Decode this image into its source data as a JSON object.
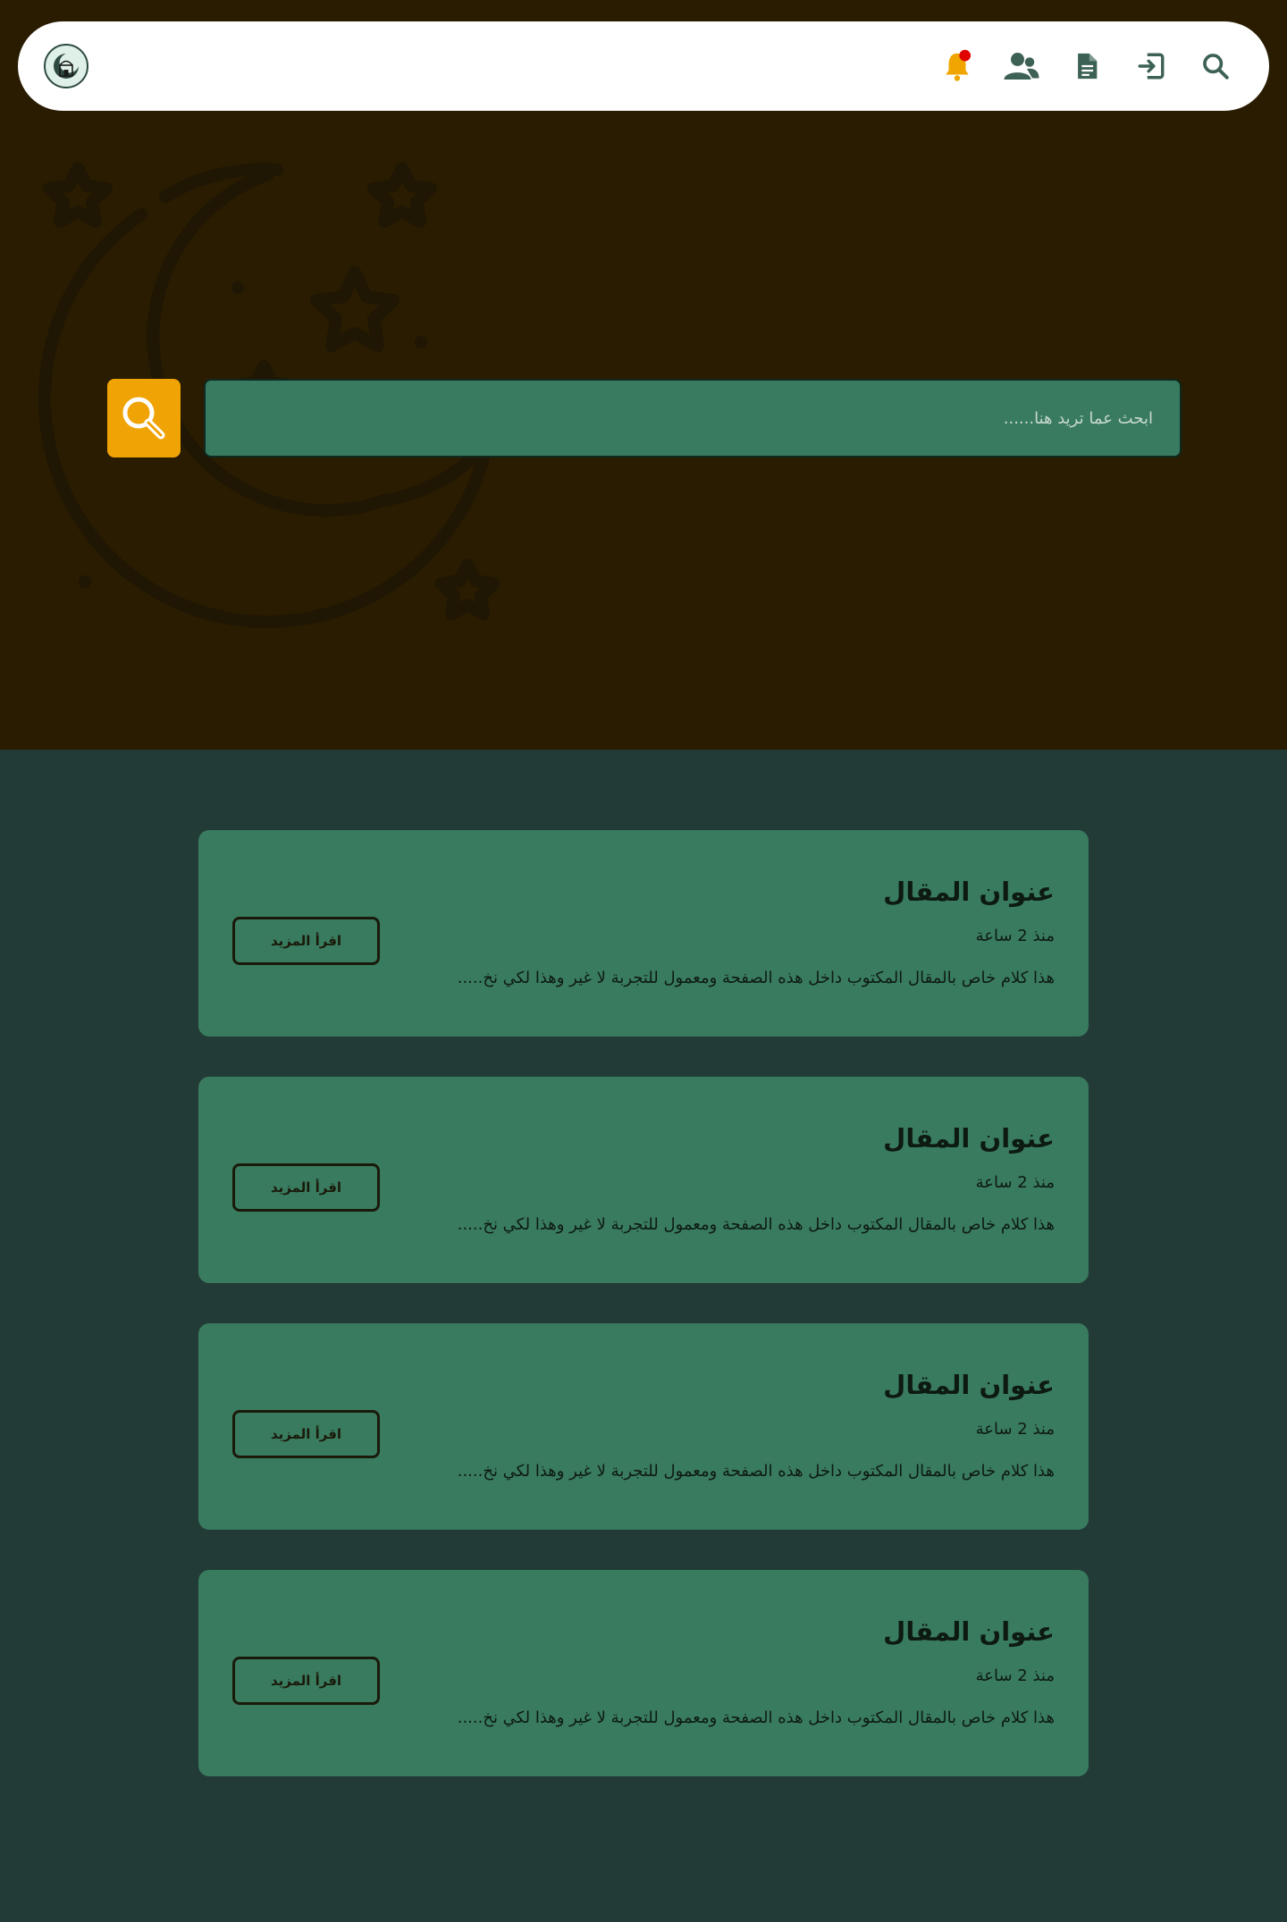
{
  "navbar": {
    "logo_icon": "mosque-logo-icon",
    "icons": [
      "search-icon",
      "login-icon",
      "document-icon",
      "users-icon",
      "bell-icon"
    ],
    "notification_dot_color": "#e00000",
    "bell_color": "#f0a500",
    "icon_color": "#3d6155"
  },
  "hero": {
    "background_color": "#291c01",
    "decoration_icon": "crescent-moon-stars-icon",
    "search": {
      "placeholder": "ابحث عما تريد هنا......",
      "button_icon": "magnifier-icon",
      "button_color": "#efa304"
    }
  },
  "articles": [
    {
      "title": "عنوان المقال",
      "time": "منذ 2 ساعة",
      "excerpt": "هذا كلام خاص بالمقال المكتوب داخل هذه الصفحة ومعمول للتجربة لا غير وهذا لكي نخ.....",
      "button_label": "اقرأ المزيد"
    },
    {
      "title": "عنوان المقال",
      "time": "منذ 2 ساعة",
      "excerpt": "هذا كلام خاص بالمقال المكتوب داخل هذه الصفحة ومعمول للتجربة لا غير وهذا لكي نخ.....",
      "button_label": "اقرأ المزيد"
    },
    {
      "title": "عنوان المقال",
      "time": "منذ 2 ساعة",
      "excerpt": "هذا كلام خاص بالمقال المكتوب داخل هذه الصفحة ومعمول للتجربة لا غير وهذا لكي نخ.....",
      "button_label": "اقرأ المزيد"
    },
    {
      "title": "عنوان المقال",
      "time": "منذ 2 ساعة",
      "excerpt": "هذا كلام خاص بالمقال المكتوب داخل هذه الصفحة ومعمول للتجربة لا غير وهذا لكي نخ.....",
      "button_label": "اقرأ المزيد"
    }
  ]
}
